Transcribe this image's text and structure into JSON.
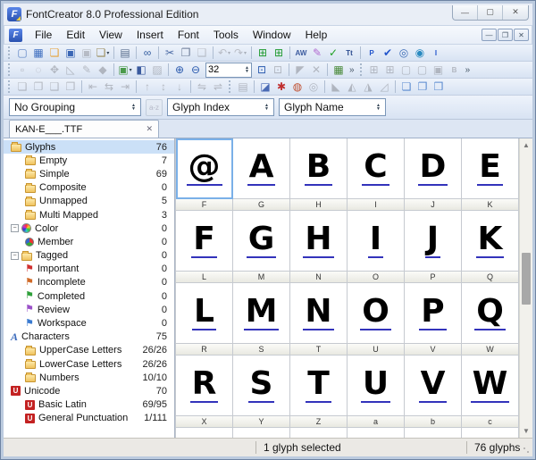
{
  "window": {
    "title": "FontCreator 8.0 Professional Edition",
    "controls": {
      "minimize": "—",
      "maximize": "▢",
      "close": "✕"
    },
    "mdi_controls": {
      "minimize": "—",
      "restore": "❐",
      "close": "✕"
    }
  },
  "menu": {
    "items": [
      "File",
      "Edit",
      "View",
      "Insert",
      "Font",
      "Tools",
      "Window",
      "Help"
    ]
  },
  "toolbars": {
    "row1": [
      {
        "grip": true
      },
      {
        "n": "new-document-icon",
        "g": "▢",
        "c": "#5b82c4"
      },
      {
        "n": "new-project-icon",
        "g": "▦",
        "c": "#3f6fc0"
      },
      {
        "n": "open-icon",
        "g": "❏",
        "c": "#e7a33a"
      },
      {
        "n": "save-icon",
        "g": "▣",
        "c": "#3a66b5"
      },
      {
        "n": "save-all-icon",
        "g": "▣",
        "c": "#667",
        "gray": true
      },
      {
        "n": "export-font-icon",
        "g": "❏",
        "c": "#9a8a5a",
        "dd": true
      },
      {
        "sep": true
      },
      {
        "n": "print-icon",
        "g": "▤",
        "c": "#5a6f8e"
      },
      {
        "sep": true
      },
      {
        "n": "find-icon",
        "g": "∞",
        "c": "#2f5a9e"
      },
      {
        "sep": true
      },
      {
        "n": "cut-icon",
        "g": "✂",
        "c": "#4a6aa5"
      },
      {
        "n": "copy-icon",
        "g": "❐",
        "c": "#6a7a95"
      },
      {
        "n": "paste-icon",
        "g": "❑",
        "c": "#667",
        "gray": true
      },
      {
        "sep": true
      },
      {
        "n": "undo-icon",
        "g": "↶",
        "c": "#667",
        "gray": true,
        "dd": true
      },
      {
        "n": "redo-icon",
        "g": "↷",
        "c": "#667",
        "gray": true,
        "dd": true
      },
      {
        "sep": true
      },
      {
        "n": "insert-characters-icon",
        "g": "⊞",
        "c": "#1f9a30"
      },
      {
        "n": "insert-glyphs-icon",
        "g": "⊞",
        "c": "#1f9a30"
      },
      {
        "sep": true
      },
      {
        "n": "autometrics-icon",
        "g": "AW",
        "c": "#3a5a9e",
        "small": true
      },
      {
        "n": "glyph-transformer-icon",
        "g": "✎",
        "c": "#b06ad0"
      },
      {
        "n": "validation-wizard-icon",
        "g": "✓",
        "c": "#1fa024"
      },
      {
        "n": "test-font-icon",
        "g": "Tt",
        "c": "#2a4a8e",
        "small": true
      },
      {
        "sep": true
      },
      {
        "n": "preview-icon",
        "g": "P",
        "c": "#2255cc",
        "small": true
      },
      {
        "n": "validate-icon",
        "g": "✔",
        "c": "#2255cc"
      },
      {
        "n": "compare-fonts-icon",
        "g": "◎",
        "c": "#3a6ab5"
      },
      {
        "n": "web-preview-icon",
        "g": "◉",
        "c": "#2a8ac0"
      },
      {
        "n": "insert-code-icon",
        "g": "I",
        "c": "#2255cc",
        "small": true
      }
    ],
    "row2": [
      {
        "grip": true
      },
      {
        "n": "select-rectangle-icon",
        "g": "▫",
        "c": "#556",
        "gray": true
      },
      {
        "n": "lasso-icon",
        "g": "◌",
        "c": "#556",
        "gray": true
      },
      {
        "n": "hand-tool-icon",
        "g": "✥",
        "c": "#556",
        "gray": true
      },
      {
        "n": "contour-tool-icon",
        "g": "◺",
        "c": "#556",
        "gray": true
      },
      {
        "n": "draw-tool-icon",
        "g": "✎",
        "c": "#556",
        "gray": true
      },
      {
        "n": "fill-tool-icon",
        "g": "◆",
        "c": "#556",
        "gray": true
      },
      {
        "sep": true
      },
      {
        "n": "import-image-icon",
        "g": "▣",
        "c": "#4a9a4a",
        "dd": true
      },
      {
        "n": "toggle-contrast-icon",
        "g": "◧",
        "c": "#3a5a9e"
      },
      {
        "n": "metrics-view-icon",
        "g": "▨",
        "c": "#556",
        "gray": true
      },
      {
        "sep": true
      },
      {
        "n": "zoom-in-icon",
        "g": "⊕",
        "c": "#2a5aae"
      },
      {
        "n": "zoom-out-icon",
        "g": "⊖",
        "c": "#2a5aae"
      },
      {
        "zoomcombo": true
      },
      {
        "n": "zoom-fit-icon",
        "g": "⊡",
        "c": "#2a5aae"
      },
      {
        "n": "zoom-selection-icon",
        "g": "⊡",
        "c": "#556",
        "gray": true
      },
      {
        "sep": true
      },
      {
        "n": "pointer-mode-icon",
        "g": "◤",
        "c": "#556",
        "gray": true
      },
      {
        "n": "contour-select-icon",
        "g": "✕",
        "c": "#556",
        "gray": true
      },
      {
        "sep": true
      },
      {
        "n": "background-image-icon",
        "g": "▦",
        "c": "#4a8a3a"
      },
      {
        "chev": true
      },
      {
        "grip": true
      },
      {
        "n": "show-grid-icon",
        "g": "⊞",
        "c": "#556",
        "gray": true
      },
      {
        "n": "grid-options-icon",
        "g": "⊞",
        "c": "#556",
        "gray": true
      },
      {
        "n": "show-guidelines-icon",
        "g": "▢",
        "c": "#556",
        "gray": true
      },
      {
        "n": "snap-to-guides-icon",
        "g": "▢",
        "c": "#556",
        "gray": true
      },
      {
        "n": "smart-snap-icon",
        "g": "▣",
        "c": "#556",
        "gray": true
      },
      {
        "n": "show-bearings-icon",
        "g": "B",
        "c": "#556",
        "gray": true,
        "small": true
      },
      {
        "chev": true
      }
    ],
    "row3": [
      {
        "grip": true
      },
      {
        "n": "bring-to-front-icon",
        "g": "❏",
        "c": "#556",
        "gray": true
      },
      {
        "n": "send-to-back-icon",
        "g": "❐",
        "c": "#556",
        "gray": true
      },
      {
        "n": "bring-forward-icon",
        "g": "❑",
        "c": "#556",
        "gray": true
      },
      {
        "n": "send-backward-icon",
        "g": "❒",
        "c": "#556",
        "gray": true
      },
      {
        "sep": true
      },
      {
        "n": "align-left-icon",
        "g": "⇤",
        "c": "#556",
        "gray": true
      },
      {
        "n": "align-center-icon",
        "g": "⇆",
        "c": "#556",
        "gray": true
      },
      {
        "n": "align-right-icon",
        "g": "⇥",
        "c": "#556",
        "gray": true
      },
      {
        "sep": true
      },
      {
        "n": "align-top-icon",
        "g": "↑",
        "c": "#556",
        "gray": true
      },
      {
        "n": "align-middle-icon",
        "g": "↕",
        "c": "#556",
        "gray": true
      },
      {
        "n": "align-bottom-icon",
        "g": "↓",
        "c": "#556",
        "gray": true
      },
      {
        "sep": true
      },
      {
        "n": "distribute-h-icon",
        "g": "⇋",
        "c": "#556",
        "gray": true
      },
      {
        "n": "distribute-v-icon",
        "g": "⇌",
        "c": "#556",
        "gray": true
      },
      {
        "grip": true
      },
      {
        "n": "glyph-properties-icon",
        "g": "▤",
        "c": "#556",
        "gray": true
      },
      {
        "sep": true
      },
      {
        "n": "eraser-icon",
        "g": "◪",
        "c": "#4a6ab5"
      },
      {
        "n": "overlap-icon",
        "g": "✱",
        "c": "#c03030"
      },
      {
        "n": "rotate-3d-icon",
        "g": "◍",
        "c": "#c05030"
      },
      {
        "n": "rotate-ring-icon",
        "g": "◎",
        "c": "#556",
        "gray": true
      },
      {
        "sep": true
      },
      {
        "n": "flip-diagonal-icon",
        "g": "◣",
        "c": "#556",
        "gray": true
      },
      {
        "n": "flip-horizontal-icon",
        "g": "◭",
        "c": "#556",
        "gray": true
      },
      {
        "n": "flip-vertical-icon",
        "g": "◮",
        "c": "#556",
        "gray": true
      },
      {
        "n": "skew-icon",
        "g": "◿",
        "c": "#556",
        "gray": true
      },
      {
        "sep": true
      },
      {
        "n": "weld-union-icon",
        "g": "❏",
        "c": "#5a8ad0"
      },
      {
        "n": "weld-intersect-icon",
        "g": "❐",
        "c": "#5a8ad0"
      },
      {
        "n": "weld-exclude-icon",
        "g": "❒",
        "c": "#5a8ad0"
      }
    ]
  },
  "zoom_value": "32",
  "filters": {
    "grouping": "No Grouping",
    "sort_primary": "Glyph Index",
    "sort_secondary": "Glyph Name"
  },
  "tab": {
    "label": "KAN-E___.TTF",
    "close": "✕"
  },
  "tree": {
    "items": [
      {
        "label": "Glyphs",
        "count": "76",
        "icon": "folder",
        "level": 0,
        "selected": true
      },
      {
        "label": "Empty",
        "count": "7",
        "icon": "folder",
        "level": 1
      },
      {
        "label": "Simple",
        "count": "69",
        "icon": "folder",
        "level": 1
      },
      {
        "label": "Composite",
        "count": "0",
        "icon": "folder",
        "level": 1
      },
      {
        "label": "Unmapped",
        "count": "5",
        "icon": "folder",
        "level": 1
      },
      {
        "label": "Multi Mapped",
        "count": "3",
        "icon": "folder",
        "level": 1
      },
      {
        "label": "Color",
        "count": "0",
        "icon": "wheel",
        "level": 0,
        "expander": true
      },
      {
        "label": "Member",
        "count": "0",
        "icon": "pie",
        "level": 1
      },
      {
        "label": "Tagged",
        "count": "0",
        "icon": "folder",
        "level": 0,
        "expander": true
      },
      {
        "label": "Important",
        "count": "0",
        "icon": "flag",
        "flagcolor": "#d03030",
        "level": 1
      },
      {
        "label": "Incomplete",
        "count": "0",
        "icon": "flag",
        "flagcolor": "#d06a28",
        "level": 1
      },
      {
        "label": "Completed",
        "count": "0",
        "icon": "flag",
        "flagcolor": "#2fa03a",
        "level": 1
      },
      {
        "label": "Review",
        "count": "0",
        "icon": "flag",
        "flagcolor": "#9a50c8",
        "level": 1
      },
      {
        "label": "Workspace",
        "count": "0",
        "icon": "flag",
        "flagcolor": "#3a7ad0",
        "level": 1
      },
      {
        "label": "Characters",
        "count": "75",
        "icon": "chara",
        "level": 0
      },
      {
        "label": "UpperCase Letters",
        "count": "26/26",
        "icon": "folder",
        "level": 1
      },
      {
        "label": "LowerCase Letters",
        "count": "26/26",
        "icon": "folder",
        "level": 1
      },
      {
        "label": "Numbers",
        "count": "10/10",
        "icon": "folder",
        "level": 1
      },
      {
        "label": "Unicode",
        "count": "70",
        "icon": "uni",
        "level": 0
      },
      {
        "label": "Basic Latin",
        "count": "69/95",
        "icon": "uni",
        "level": 1
      },
      {
        "label": "General Punctuation",
        "count": "1/111",
        "icon": "uni",
        "level": 1
      }
    ]
  },
  "grid": {
    "rows": [
      {
        "labels": [
          "F",
          "G",
          "H",
          "I",
          "J",
          "K"
        ],
        "glyphs": [
          "@",
          "A",
          "B",
          "C",
          "D",
          "E"
        ]
      },
      {
        "labels": [
          "L",
          "M",
          "N",
          "O",
          "P",
          "Q"
        ],
        "glyphs": [
          "F",
          "G",
          "H",
          "I",
          "J",
          "K"
        ]
      },
      {
        "labels": [
          "R",
          "S",
          "T",
          "U",
          "V",
          "W"
        ],
        "glyphs": [
          "L",
          "M",
          "N",
          "O",
          "P",
          "Q"
        ]
      },
      {
        "labels": [
          "X",
          "Y",
          "Z",
          "a",
          "b",
          "c"
        ],
        "glyphs": [
          "R",
          "S",
          "T",
          "U",
          "V",
          "W"
        ]
      }
    ],
    "selected_cell": {
      "row": 0,
      "col": 0
    }
  },
  "statusbar": {
    "selection": "1 glyph selected",
    "total": "76 glyphs"
  }
}
